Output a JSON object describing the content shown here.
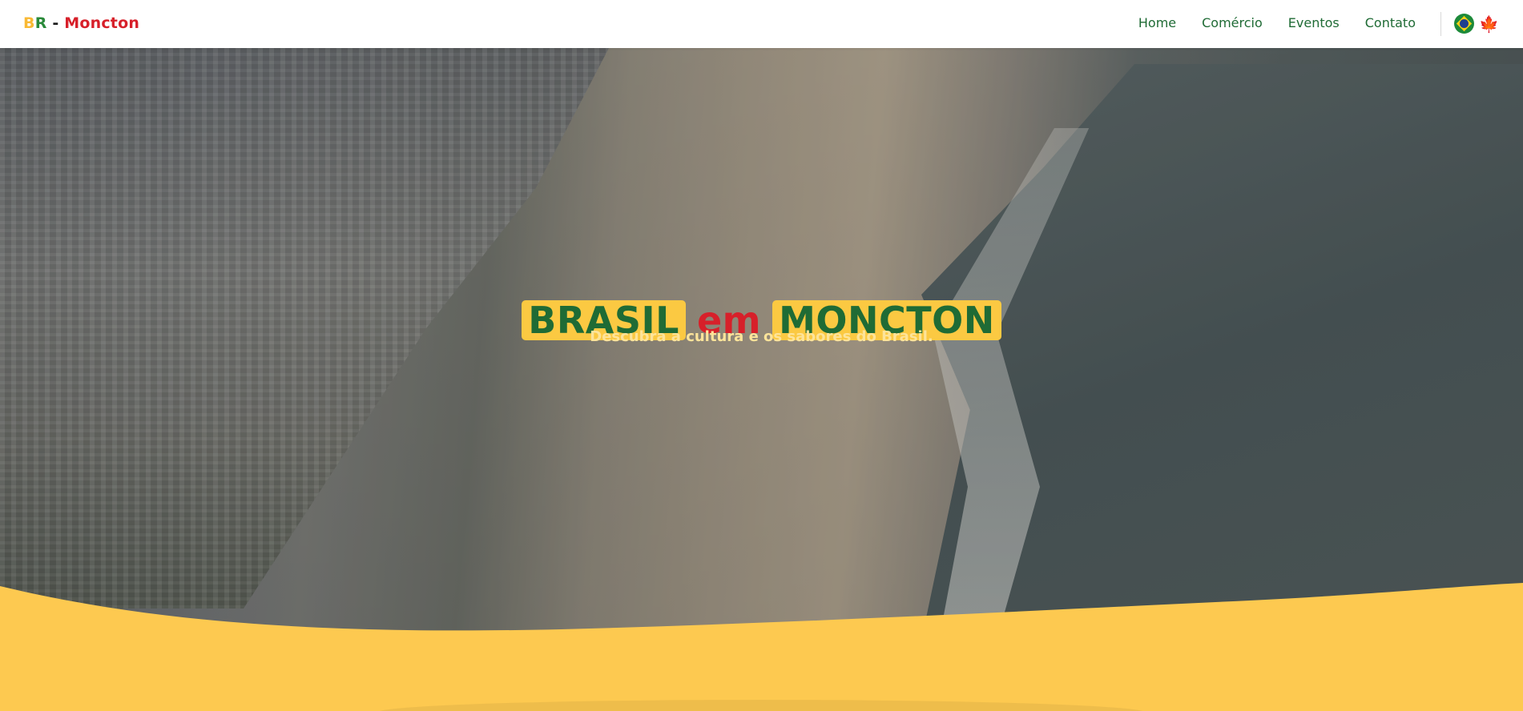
{
  "header": {
    "logo": {
      "b": "B",
      "r": "R",
      "dash": " - ",
      "city": "Moncton"
    },
    "nav": [
      {
        "label": "Home"
      },
      {
        "label": "Comércio"
      },
      {
        "label": "Eventos"
      },
      {
        "label": "Contato"
      }
    ],
    "languages": [
      {
        "icon": "brazil-flag-icon"
      },
      {
        "icon": "canada-flag-icon"
      }
    ]
  },
  "hero": {
    "title_part1": "BRASIL",
    "title_part2": "em",
    "title_part3": "MONCTON",
    "subtitle": "Descubra a cultura e os sabores do Brasil."
  },
  "colors": {
    "green": "#1f6b35",
    "yellow": "#fbc942",
    "red": "#d7202a",
    "wave": "#fdc950"
  }
}
